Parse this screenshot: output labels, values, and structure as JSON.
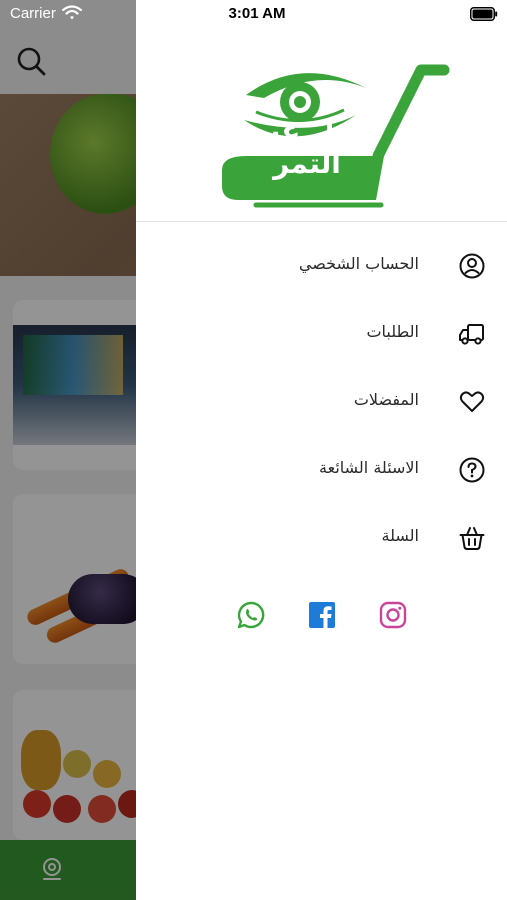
{
  "status_bar": {
    "carrier": "Carrier",
    "time": "3:01 AM"
  },
  "logo": {
    "text": "مول عين التمر",
    "brand_color": "#3aa33a"
  },
  "menu": {
    "items": [
      {
        "label": "الحساب الشخصي",
        "icon": "user-circle-icon"
      },
      {
        "label": "الطلبات",
        "icon": "truck-icon"
      },
      {
        "label": "المفضلات",
        "icon": "heart-icon"
      },
      {
        "label": "الاسئلة الشائعة",
        "icon": "question-circle-icon"
      },
      {
        "label": "السلة",
        "icon": "basket-icon"
      }
    ]
  },
  "social": {
    "whatsapp": {
      "icon": "whatsapp-icon",
      "color": "#3aa33a"
    },
    "facebook": {
      "icon": "facebook-icon",
      "color": "#1f7bd8"
    },
    "instagram": {
      "icon": "instagram-icon",
      "color": "#c8469a"
    }
  },
  "colors": {
    "bottom_bar": "#3c9a36",
    "overlay": "rgba(0,0,0,0.42)"
  }
}
